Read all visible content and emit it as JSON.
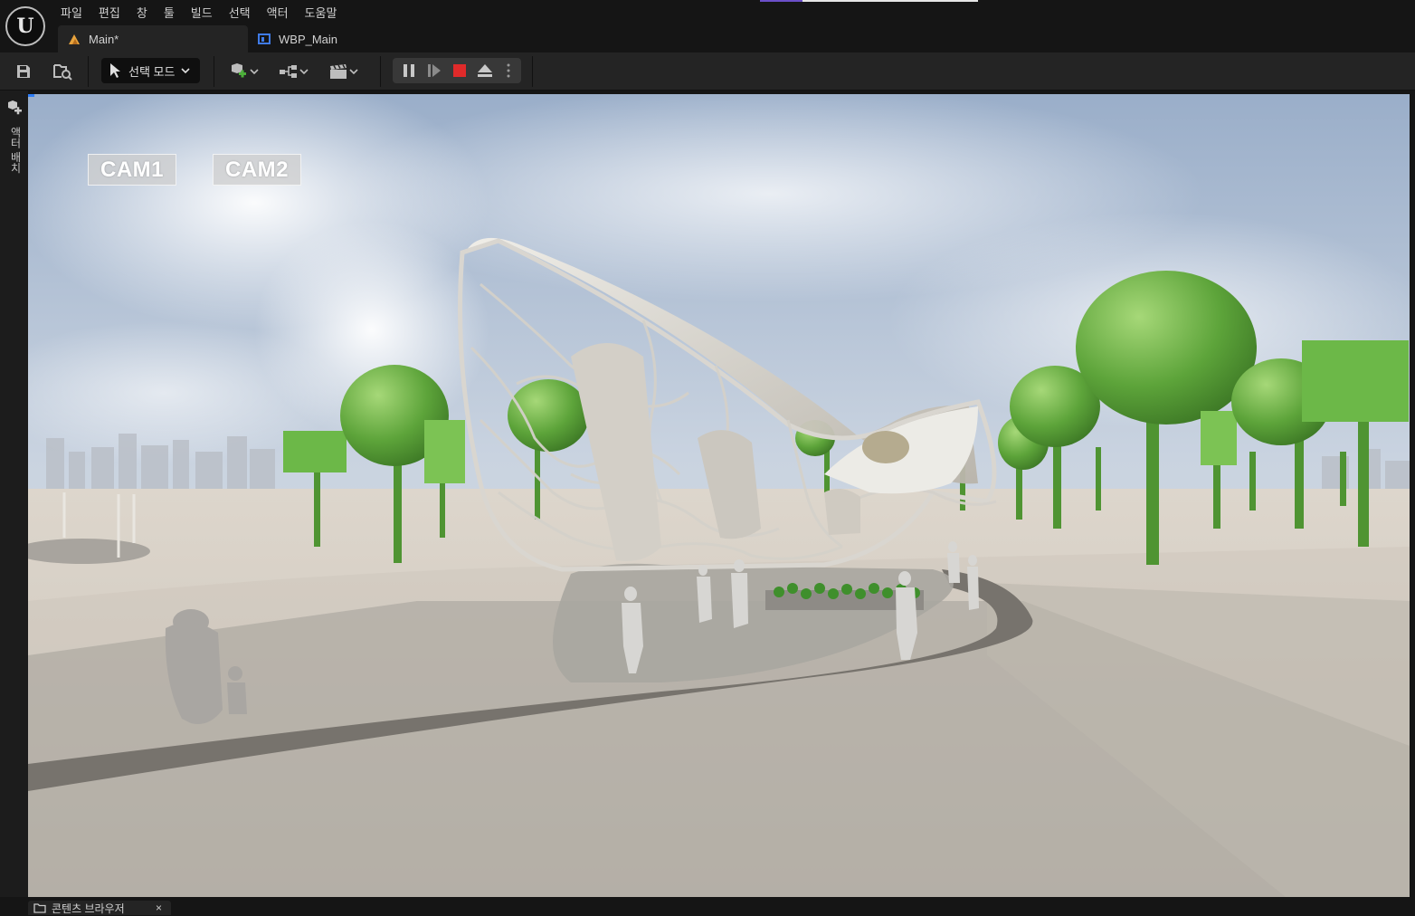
{
  "app": {
    "logo": "U",
    "menu": [
      "파일",
      "편집",
      "창",
      "툴",
      "빌드",
      "선택",
      "액터",
      "도움말"
    ]
  },
  "tabs": [
    {
      "label": "Main*",
      "icon": "level-icon",
      "active": true
    },
    {
      "label": "WBP_Main",
      "icon": "widget-blueprint-icon",
      "active": false
    }
  ],
  "toolbar": {
    "save_icon": "save-icon",
    "browse_icon": "browse-icon",
    "mode_label": "선택 모드",
    "add_icon": "add-actor-icon",
    "blueprint_icon": "blueprint-icon",
    "cinematics_icon": "clapper-icon",
    "play_controls": [
      "pause-icon",
      "step-icon",
      "stop-icon",
      "eject-icon",
      "more-icon"
    ]
  },
  "sidebar": {
    "label": "액터 배치",
    "icon": "place-actor-icon"
  },
  "viewport": {
    "cam_buttons": [
      "CAM1",
      "CAM2"
    ],
    "accent_color": "#2d7cf6"
  },
  "bottom": {
    "content_browser_label": "콘텐츠 브라우저",
    "close_symbol": "×"
  },
  "colors": {
    "stop_red": "#e02a2a",
    "tree_green": "#5da43a",
    "menu_accent": "#6b4fc8"
  }
}
